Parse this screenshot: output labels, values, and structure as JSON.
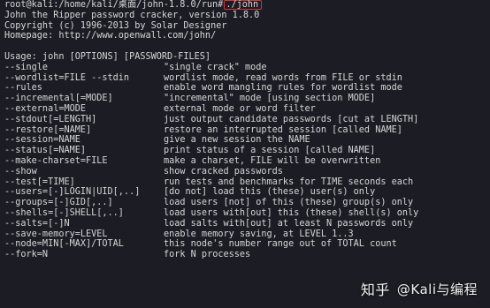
{
  "prompt": {
    "user_host_path": "root@kali:/home/kali/桌面/john-1.8.0/run#",
    "command": "./john"
  },
  "header_lines": [
    "John the Ripper password cracker, version 1.8.0",
    "Copyright (c) 1996-2013 by Solar Designer",
    "Homepage: http://www.openwall.com/john/"
  ],
  "usage": "Usage: john [OPTIONS] [PASSWORD-FILES]",
  "options": [
    {
      "name": "--single",
      "desc": "\"single crack\" mode"
    },
    {
      "name": "--wordlist=FILE --stdin",
      "desc": "wordlist mode, read words from FILE or stdin"
    },
    {
      "name": "--rules",
      "desc": "enable word mangling rules for wordlist mode"
    },
    {
      "name": "--incremental[=MODE]",
      "desc": "\"incremental\" mode [using section MODE]"
    },
    {
      "name": "--external=MODE",
      "desc": "external mode or word filter"
    },
    {
      "name": "--stdout[=LENGTH]",
      "desc": "just output candidate passwords [cut at LENGTH]"
    },
    {
      "name": "--restore[=NAME]",
      "desc": "restore an interrupted session [called NAME]"
    },
    {
      "name": "--session=NAME",
      "desc": "give a new session the NAME"
    },
    {
      "name": "--status[=NAME]",
      "desc": "print status of a session [called NAME]"
    },
    {
      "name": "--make-charset=FILE",
      "desc": "make a charset, FILE will be overwritten"
    },
    {
      "name": "--show",
      "desc": "show cracked passwords"
    },
    {
      "name": "--test[=TIME]",
      "desc": "run tests and benchmarks for TIME seconds each"
    },
    {
      "name": "--users=[-]LOGIN|UID[,..]",
      "desc": "[do not] load this (these) user(s) only"
    },
    {
      "name": "--groups=[-]GID[,..]",
      "desc": "load users [not] of this (these) group(s) only"
    },
    {
      "name": "--shells=[-]SHELL[,..]",
      "desc": "load users with[out] this (these) shell(s) only"
    },
    {
      "name": "--salts=[-]N",
      "desc": "load salts with[out] at least N passwords only"
    },
    {
      "name": "--save-memory=LEVEL",
      "desc": "enable memory saving, at LEVEL 1..3"
    },
    {
      "name": "--node=MIN[-MAX]/TOTAL",
      "desc": "this node's number range out of TOTAL count"
    },
    {
      "name": "--fork=N",
      "desc": "fork N processes"
    }
  ],
  "watermark": {
    "logo": "知乎",
    "handle": "@Kali与编程"
  },
  "colors": {
    "background": "#1c1d24",
    "text": "#d6d6d6",
    "command_highlight_border": "#e03030"
  }
}
